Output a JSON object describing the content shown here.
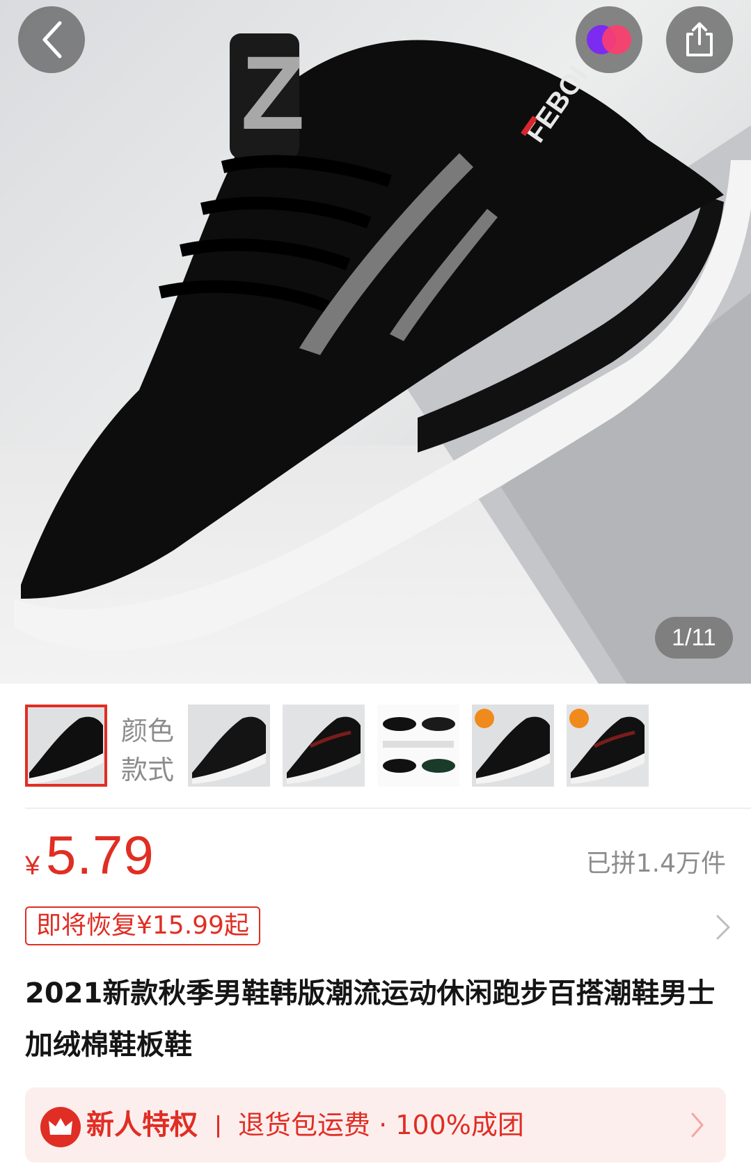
{
  "hero": {
    "image_counter": "1/11",
    "icons": {
      "back": "back-arrow-icon",
      "brand": "brand-logo-icon",
      "share": "share-icon"
    }
  },
  "thumbnails": {
    "color_label": "颜色\n款式",
    "selected_index": 0,
    "count": 6
  },
  "price": {
    "currency": "¥",
    "value": "5.79",
    "sold": "已拼1.4万件",
    "restore_tag": "即将恢复¥15.99起"
  },
  "product": {
    "title": "2021新款秋季男鞋韩版潮流运动休闲跑步百搭潮鞋男士加绒棉鞋板鞋"
  },
  "new_user_bar": {
    "title": "新人特权",
    "text": "退货包运费 · 100%成团"
  },
  "colors": {
    "accent": "#e02e24",
    "muted": "#8c8c8c",
    "bar_bg": "#fdeeee"
  }
}
